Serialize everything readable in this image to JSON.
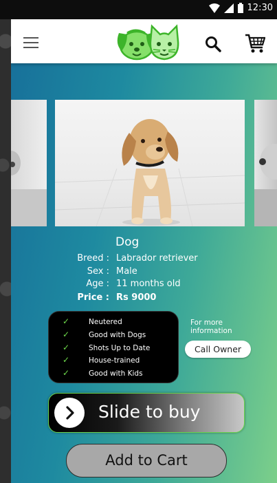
{
  "status_bar": {
    "time": "12:30"
  },
  "app_bar": {
    "menu_icon": "hamburger-menu-icon",
    "logo": "dog-and-cat-logo",
    "search_icon": "search-icon",
    "cart_icon": "shopping-cart-icon"
  },
  "pet": {
    "name": "Dog",
    "details": [
      {
        "label": "Breed :",
        "value": "Labrador retriever"
      },
      {
        "label": "Sex :",
        "value": "Male"
      },
      {
        "label": "Age :",
        "value": "11 months old"
      },
      {
        "label": "Price :",
        "value": "Rs 9000"
      }
    ]
  },
  "features": [
    "Neutered",
    "Good with Dogs",
    "Shots Up to Date",
    "House-trained",
    "Good with Kids"
  ],
  "contact": {
    "more_info": "For more information",
    "call_label": "Call Owner"
  },
  "actions": {
    "slide_label": "Slide to buy",
    "add_to_cart_label": "Add to Cart"
  },
  "colors": {
    "accent_green": "#6fdc4c",
    "gradient_start": "#176f9a",
    "gradient_end": "#7ccf8a"
  }
}
